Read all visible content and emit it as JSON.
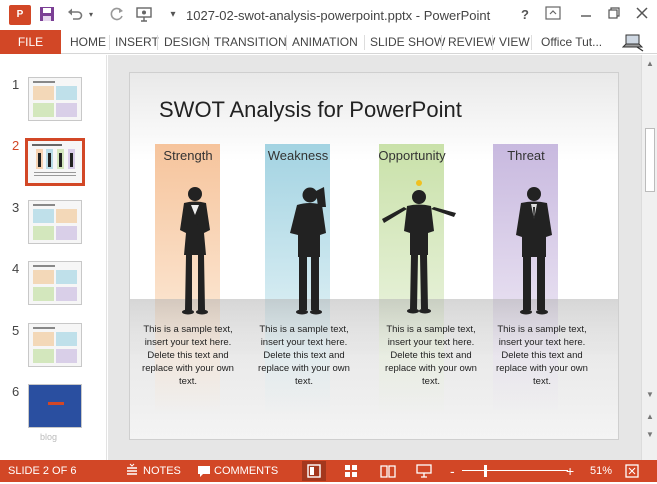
{
  "titlebar": {
    "app_icon": "P",
    "document_title": "1027-02-swot-analysis-powerpoint.pptx - PowerPoint",
    "icons": [
      "save-icon",
      "undo-icon",
      "redo-icon",
      "start-from-beginning-icon",
      "customize-quick-access-icon"
    ],
    "window_buttons": [
      "?",
      "ribbon-display-options",
      "minimize",
      "restore",
      "close"
    ]
  },
  "ribbon": {
    "file_label": "FILE",
    "tabs": [
      "HOME",
      "INSERT",
      "DESIGN",
      "TRANSITION",
      "ANIMATION",
      "SLIDE SHOW",
      "REVIEW",
      "VIEW"
    ],
    "account": "Office Tut..."
  },
  "thumbnails": {
    "numbers": [
      "1",
      "2",
      "3",
      "4",
      "5",
      "6"
    ],
    "active_index": 2,
    "blog_text": "blog"
  },
  "slide": {
    "title": "SWOT Analysis for PowerPoint",
    "columns": [
      {
        "label": "Strength",
        "color": "#f6c9a4",
        "text": "This is a sample text, insert your text here. Delete this text and replace with your own text."
      },
      {
        "label": "Weakness",
        "color": "#a9d6e4",
        "text": "This is a sample text, insert your text here. Delete this text and replace with your own text."
      },
      {
        "label": "Opportunity",
        "color": "#cde3b0",
        "text": "This is a sample text, insert your text here. Delete this text and replace with your own text."
      },
      {
        "label": "Threat",
        "color": "#cfc2e2",
        "text": "This is a sample text, insert your text here. Delete this text and replace with your own text."
      }
    ]
  },
  "status": {
    "slide_info": "SLIDE 2 OF 6",
    "notes": "NOTES",
    "comments": "COMMENTS",
    "zoom": "51%",
    "zoom_minus": "-",
    "zoom_plus": "+",
    "accent": "#d24726"
  }
}
